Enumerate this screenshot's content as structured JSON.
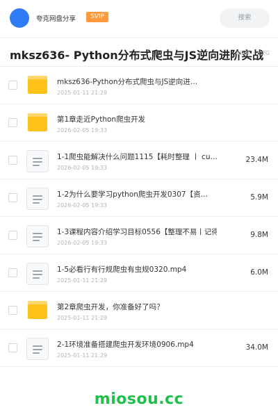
{
  "header": {
    "brand": "夸克网盘分享",
    "badge": "SVIP",
    "search_placeholder": "搜索"
  },
  "share": {
    "title": "mksz636- Python分布式爬虫与JS逆向进阶实战",
    "meta_count": "08 项",
    "meta_sep": "·",
    "meta_size": "3.2G"
  },
  "files": [
    {
      "type": "folder",
      "name": "mksz636-Python分布式爬虫与JS逆向进…",
      "date": "2025-01-11 21:29",
      "size": ""
    },
    {
      "type": "folder",
      "name": "第1章走近Python爬虫开发",
      "date": "2026-02-05 19:33",
      "size": ""
    },
    {
      "type": "file",
      "name": "1-1爬虫能解决什么问题1115【耗时整理 丨 cu…",
      "date": "2026-02-05 19:33",
      "size": "23.4M"
    },
    {
      "type": "file",
      "name": "1-2为什么要学习python爬虫开发0307【资…",
      "date": "2026-02-05 19:33",
      "size": "5.9M"
    },
    {
      "type": "file",
      "name": "1-3课程内容介绍学习目标0556【整理不易丨记得…",
      "date": "2026-02-05 19:33",
      "size": "9.8M"
    },
    {
      "type": "file",
      "name": "1-5必看行有行规爬虫有虫规0320.mp4",
      "date": "2025-01-11 21:29",
      "size": "6.0M"
    },
    {
      "type": "folder",
      "name": "第2章爬虫开发，你准备好了吗？",
      "date": "2025-01-11 21:29",
      "size": ""
    },
    {
      "type": "file",
      "name": "2-1环境准备搭建爬虫开发环境0906.mp4",
      "date": "2025-01-11 21:29",
      "size": "34.0M"
    }
  ],
  "watermark": "miosou.cc",
  "colors": {
    "avatar": "#2f7cf6",
    "badge": "#ff9a3c",
    "folder": "#ffc21a",
    "watermark": "#1fbf4a"
  }
}
